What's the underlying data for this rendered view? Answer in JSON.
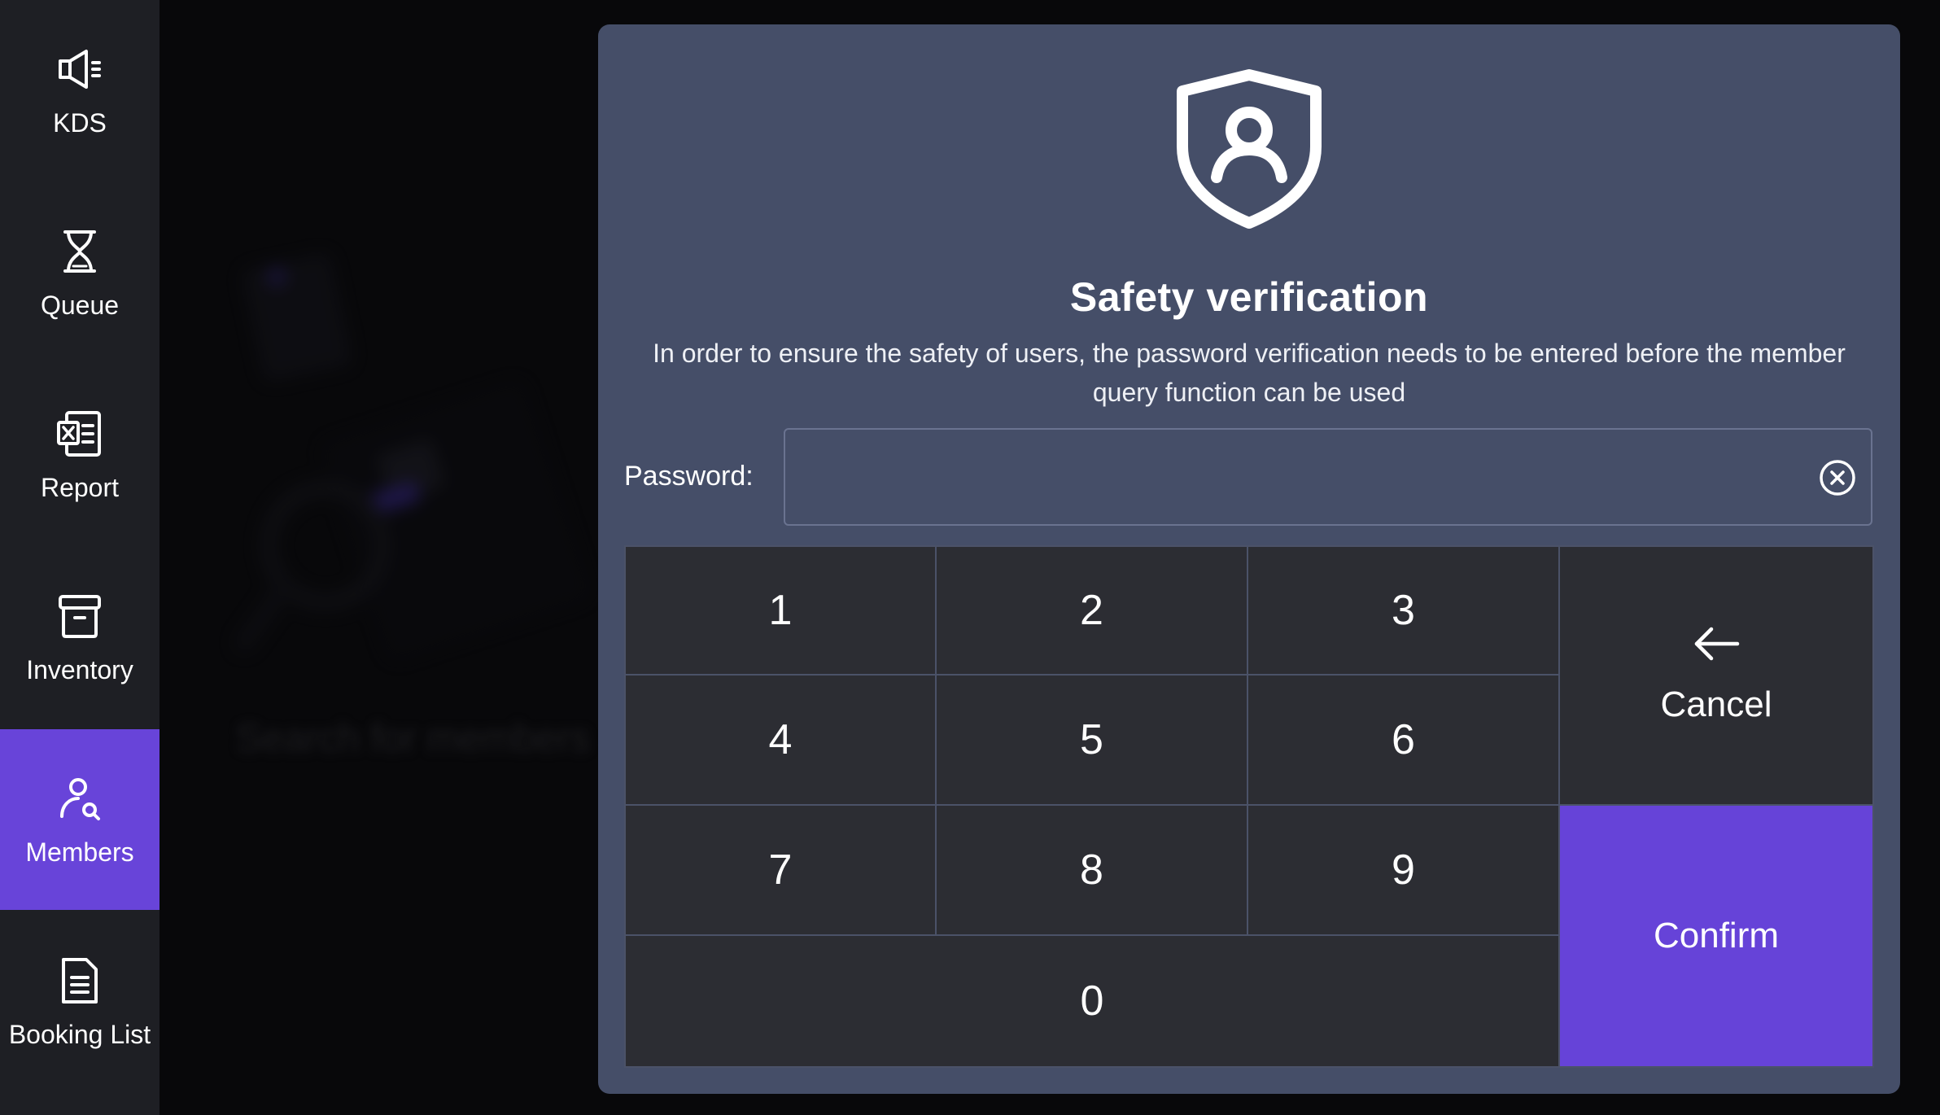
{
  "sidebar": {
    "items": [
      {
        "label": "KDS",
        "icon": "speaker-icon",
        "active": false
      },
      {
        "label": "Queue",
        "icon": "hourglass-icon",
        "active": false
      },
      {
        "label": "Report",
        "icon": "excel-report-icon",
        "active": false
      },
      {
        "label": "Inventory",
        "icon": "archive-box-icon",
        "active": false
      },
      {
        "label": "Members",
        "icon": "member-search-icon",
        "active": true
      },
      {
        "label": "Booking List",
        "icon": "document-icon",
        "active": false
      }
    ]
  },
  "background": {
    "search_text": "Search for members"
  },
  "modal": {
    "icon": "shield-user-icon",
    "title": "Safety verification",
    "description": "In order to ensure the safety of users, the password verification needs to be entered before the member query function can be used",
    "password_label": "Password:",
    "password_value": "",
    "clear_icon": "clear-circle-icon"
  },
  "keypad": {
    "digits": [
      "1",
      "2",
      "3",
      "4",
      "5",
      "6",
      "7",
      "8",
      "9",
      "0"
    ],
    "cancel_label": "Cancel",
    "cancel_icon": "arrow-left-icon",
    "confirm_label": "Confirm"
  },
  "colors": {
    "accent": "#6844d9",
    "modal_bg": "#454e68",
    "key_bg": "#2c2d33",
    "sidebar_bg": "#1e1f24"
  }
}
